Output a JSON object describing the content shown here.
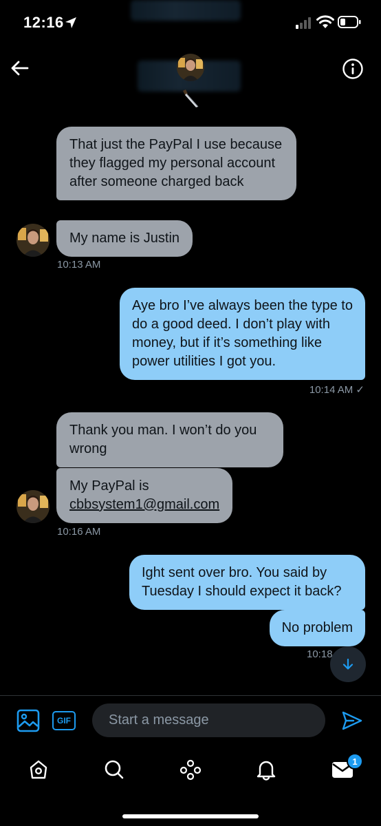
{
  "status_bar": {
    "time": "12:16",
    "icons": [
      "location-arrow-icon",
      "cellular-signal-icon",
      "wifi-icon",
      "battery-icon"
    ]
  },
  "header": {
    "icons": [
      "back-arrow-icon",
      "avatar",
      "knife-emoji-icon",
      "info-icon"
    ]
  },
  "messages": [
    {
      "direction": "in",
      "text": "That just the PayPal I use because they flagged my personal account after someone charged back"
    },
    {
      "direction": "in",
      "text": "My name is Justin"
    },
    {
      "direction": "in_time",
      "text": "10:13 AM"
    },
    {
      "direction": "out",
      "text": "Aye bro I’ve always been the type to do a good deed. I don’t play with money, but if it’s something like power utilities I got you."
    },
    {
      "direction": "out_time",
      "text": "10:14 AM ✓"
    },
    {
      "direction": "in",
      "text": "Thank you man. I won’t do you wrong"
    },
    {
      "direction": "in",
      "text_prefix": "My PayPal is",
      "email": "cbbsystem1@gmail.com"
    },
    {
      "direction": "in_time",
      "text": "10:16 AM"
    },
    {
      "direction": "out",
      "text": "Ight sent over bro. You said by Tuesday I should expect it back?"
    },
    {
      "direction": "out",
      "text": "No problem"
    },
    {
      "direction": "out_time",
      "text": "10:18"
    }
  ],
  "composer": {
    "gif_label": "GIF",
    "placeholder": "Start a message"
  },
  "tab_bar": {
    "tabs": [
      "home-icon",
      "search-icon",
      "spaces-icon",
      "notifications-icon",
      "messages-icon"
    ],
    "messages_badge": "1"
  },
  "colors": {
    "background": "#000000",
    "incoming_bubble": "#9da3ab",
    "outgoing_bubble": "#8ecdf8",
    "accent": "#1d9bf0",
    "timestamp": "#8b98a5"
  }
}
